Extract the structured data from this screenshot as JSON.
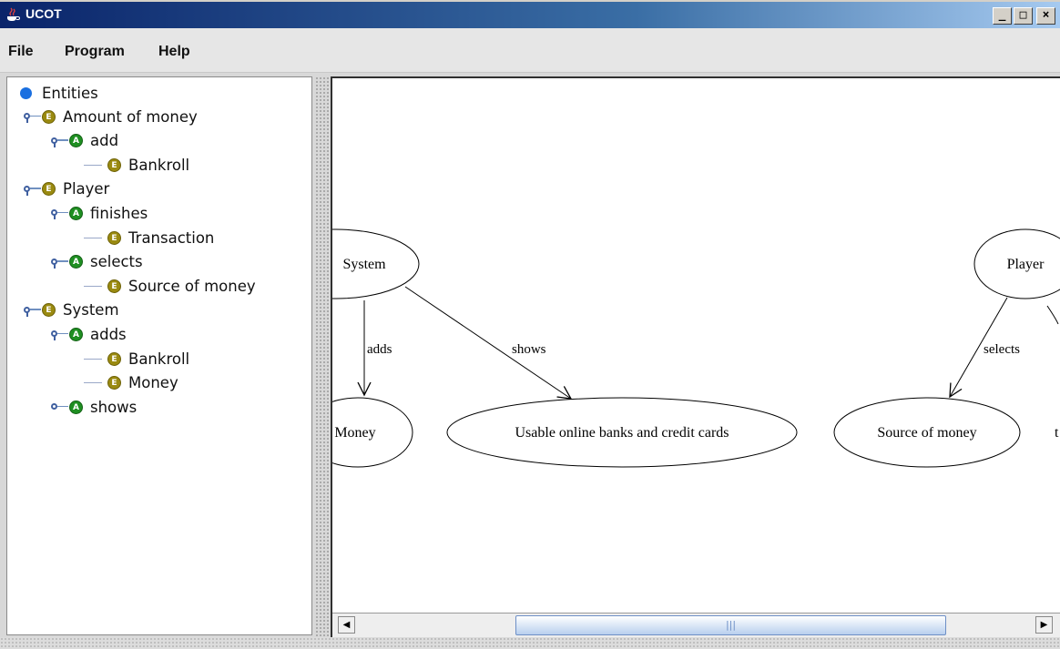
{
  "window": {
    "title": "UCOT",
    "controls": {
      "minimize": "_",
      "maximize": "□",
      "close": "×"
    },
    "app_icon": "java-coffee-cup-icon"
  },
  "menu": {
    "items": [
      "File",
      "Program",
      "Help"
    ]
  },
  "tree": {
    "root": "Entities",
    "rows": [
      {
        "label": "Amount of money",
        "badge": "E",
        "level": 1,
        "handle": "expanded"
      },
      {
        "label": "add",
        "badge": "A",
        "level": 2,
        "handle": "expanded"
      },
      {
        "label": "Bankroll",
        "badge": "E",
        "level": 3,
        "handle": "leaf"
      },
      {
        "label": "Player",
        "badge": "E",
        "level": 1,
        "handle": "expanded"
      },
      {
        "label": "finishes",
        "badge": "A",
        "level": 2,
        "handle": "expanded"
      },
      {
        "label": "Transaction",
        "badge": "E",
        "level": 3,
        "handle": "leaf"
      },
      {
        "label": "selects",
        "badge": "A",
        "level": 2,
        "handle": "expanded"
      },
      {
        "label": "Source of money",
        "badge": "E",
        "level": 3,
        "handle": "leaf"
      },
      {
        "label": "System",
        "badge": "E",
        "level": 1,
        "handle": "expanded"
      },
      {
        "label": "adds",
        "badge": "A",
        "level": 2,
        "handle": "expanded"
      },
      {
        "label": "Bankroll",
        "badge": "E",
        "level": 3,
        "handle": "leaf"
      },
      {
        "label": "Money",
        "badge": "E",
        "level": 3,
        "handle": "leaf"
      },
      {
        "label": "shows",
        "badge": "A",
        "level": 2,
        "handle": "collapsed"
      }
    ]
  },
  "graph": {
    "nodes": {
      "system": "System",
      "player": "Player",
      "money": "Money",
      "usable": "Usable online banks and credit cards",
      "source": "Source of money",
      "partial": "t"
    },
    "edges": {
      "adds": "adds",
      "shows": "shows",
      "selects": "selects"
    }
  },
  "scrollbar": {
    "left_arrow": "◀",
    "right_arrow": "▶",
    "thumb_grip": "|||"
  }
}
